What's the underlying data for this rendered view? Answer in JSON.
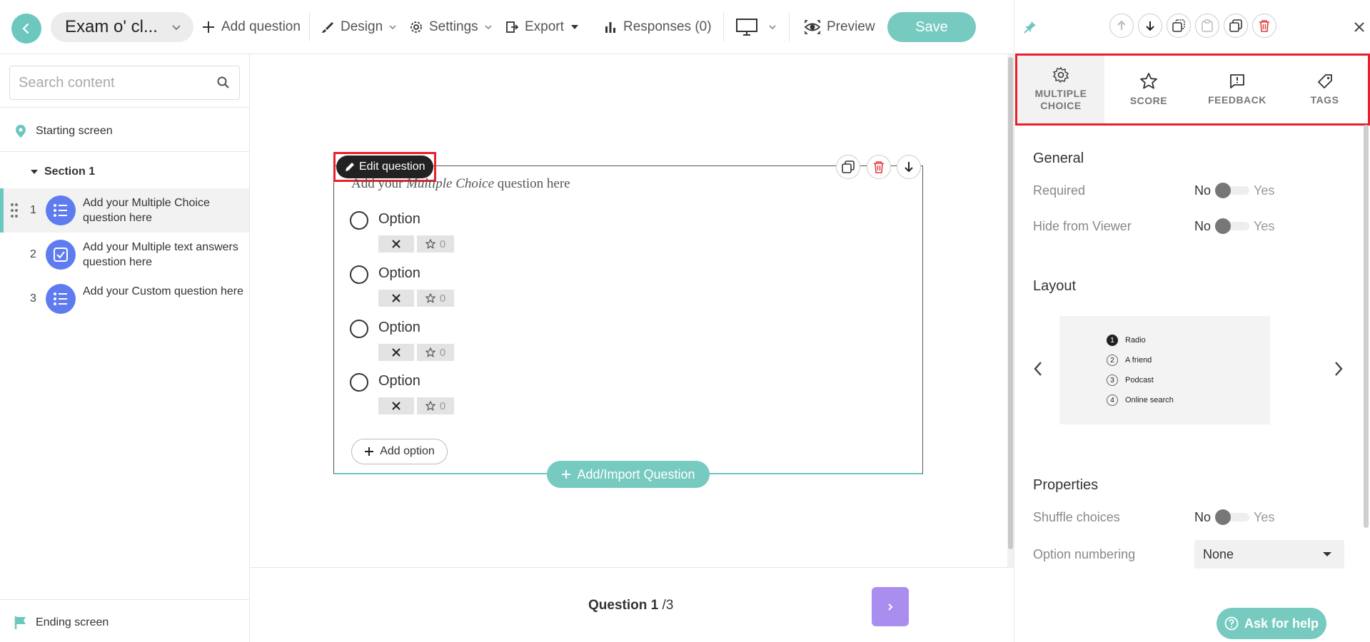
{
  "header": {
    "form_title": "Exam o' cl...",
    "add_question": "Add question",
    "design": "Design",
    "settings": "Settings",
    "export": "Export",
    "responses": "Responses (0)",
    "preview": "Preview",
    "save": "Save"
  },
  "sidebar": {
    "search_placeholder": "Search content",
    "starting_screen": "Starting screen",
    "section_title": "Section 1",
    "questions": [
      {
        "num": "1",
        "text": "Add your Multiple Choice question here",
        "icon": "list-icon"
      },
      {
        "num": "2",
        "text": "Add your Multiple text answers question here",
        "icon": "checkbox-icon"
      },
      {
        "num": "3",
        "text": "Add your Custom question here",
        "icon": "list-icon"
      }
    ],
    "ending_screen": "Ending screen"
  },
  "editor": {
    "edit_question": "Edit question",
    "title_prefix": "Add your ",
    "title_emph": "Multiple Choice",
    "title_suffix": " question here",
    "options": [
      {
        "label": "Option",
        "score": "0"
      },
      {
        "label": "Option",
        "score": "0"
      },
      {
        "label": "Option",
        "score": "0"
      },
      {
        "label": "Option",
        "score": "0"
      }
    ],
    "add_option": "Add option",
    "add_import": "Add/Import Question"
  },
  "footer": {
    "question_label": "Question 1",
    "total": " /3"
  },
  "panel": {
    "tabs": [
      {
        "label": "MULTIPLE CHOICE",
        "icon": "gear-icon"
      },
      {
        "label": "SCORE",
        "icon": "star-icon"
      },
      {
        "label": "FEEDBACK",
        "icon": "feedback-icon"
      },
      {
        "label": "TAGS",
        "icon": "tag-icon"
      }
    ],
    "general_title": "General",
    "required_label": "Required",
    "hide_label": "Hide from Viewer",
    "no": "No",
    "yes": "Yes",
    "layout_title": "Layout",
    "layout_preview": [
      "Radio",
      "A friend",
      "Podcast",
      "Online search"
    ],
    "properties_title": "Properties",
    "shuffle_label": "Shuffle choices",
    "numbering_label": "Option numbering",
    "numbering_value": "None",
    "help": "Ask for help"
  },
  "colors": {
    "accent": "#76cabf",
    "question_icon": "#5e7cf0",
    "next_button": "#a98ef0",
    "highlight": "#e8202a"
  }
}
